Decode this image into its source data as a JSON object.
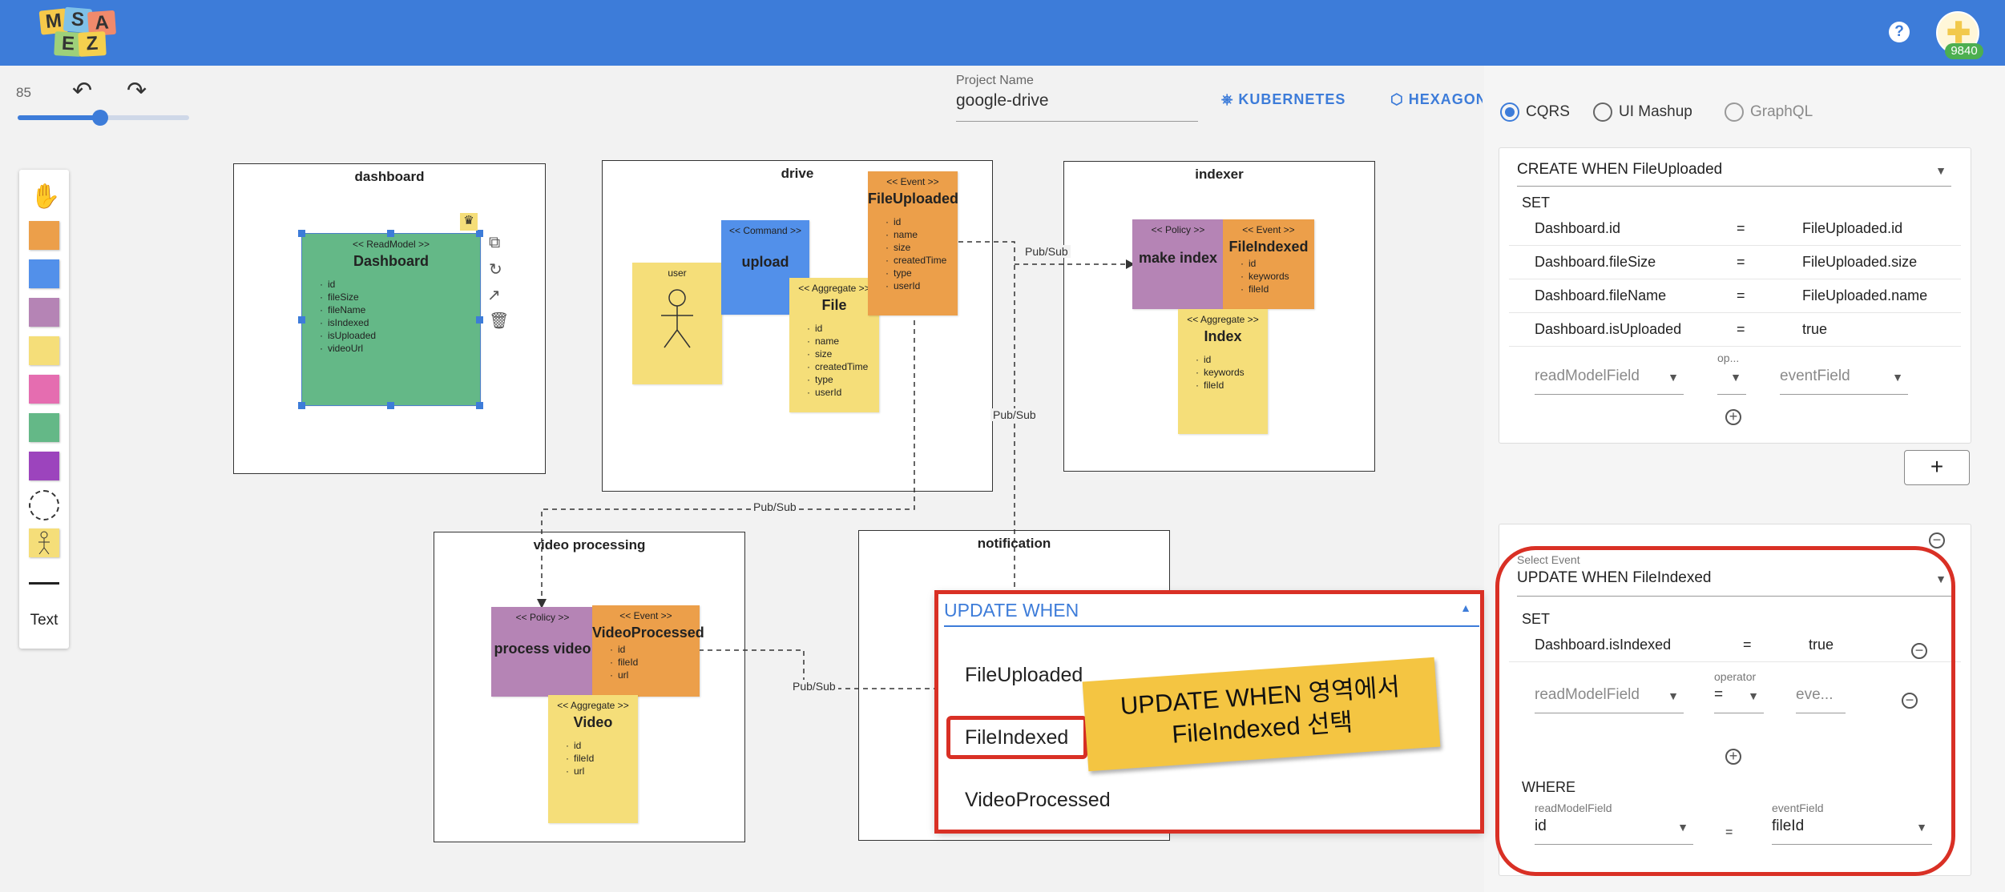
{
  "header": {
    "logo_letters": [
      "M",
      "S",
      "A",
      "E",
      "Z"
    ],
    "help_glyph": "?",
    "user_badge": "9840"
  },
  "toolbar": {
    "zoom": 85,
    "zoom_percent": 48,
    "undo_glyph": "↶",
    "redo_glyph": "↷"
  },
  "palette": {
    "items": [
      "hand-tool",
      "event-sticker",
      "command-sticker",
      "policy-sticker",
      "readmodel-sticker",
      "external-sticker",
      "aggregate-sticker",
      "ui-sticker",
      "boundary-tool",
      "actor-sticker",
      "line-tool"
    ],
    "text_label": "Text",
    "colors": {
      "event": "#ec9f4a",
      "command": "#5290ea",
      "policy": "#b584b5",
      "readmodel": "#64b887",
      "aggregate": "#f5de79",
      "external": "#e56db0",
      "ui": "#9c44bd"
    }
  },
  "project": {
    "label": "Project Name",
    "name": "google-drive"
  },
  "vendors": [
    "KUBERNETES",
    "HEXAGONAL"
  ],
  "canvas": {
    "contexts": [
      "dashboard",
      "drive",
      "indexer",
      "video processing",
      "notification"
    ],
    "stickers": {
      "dashboard": {
        "type": "<< ReadModel >>",
        "name": "Dashboard",
        "fields": [
          "id",
          "fileSize",
          "fileName",
          "isIndexed",
          "isUploaded",
          "videoUrl"
        ]
      },
      "user": {
        "type": "user"
      },
      "upload": {
        "type": "<< Command >>",
        "name": "upload"
      },
      "file_uploaded": {
        "type": "<< Event >>",
        "name": "FileUploaded",
        "fields": [
          "id",
          "name",
          "size",
          "createdTime",
          "type",
          "userId"
        ]
      },
      "file": {
        "type": "<< Aggregate >>",
        "name": "File",
        "fields": [
          "id",
          "name",
          "size",
          "createdTime",
          "type",
          "userId"
        ]
      },
      "make_index": {
        "type": "<< Policy >>",
        "name": "make index"
      },
      "file_indexed": {
        "type": "<< Event >>",
        "name": "FileIndexed",
        "fields": [
          "id",
          "keywords",
          "fileId"
        ]
      },
      "index": {
        "type": "<< Aggregate >>",
        "name": "Index",
        "fields": [
          "id",
          "keywords",
          "fileId"
        ]
      },
      "process_video": {
        "type": "<< Policy >>",
        "name": "process video"
      },
      "video_processed": {
        "type": "<< Event >>",
        "name": "VideoProcessed",
        "fields": [
          "id",
          "fileId",
          "url"
        ]
      },
      "video": {
        "type": "<< Aggregate >>",
        "name": "Video",
        "fields": [
          "id",
          "fileId",
          "url"
        ]
      }
    },
    "connection_label": "Pub/Sub"
  },
  "panel": {
    "modes": [
      "CQRS",
      "UI Mashup",
      "GraphQL"
    ],
    "selected_mode": "CQRS",
    "create_card": {
      "select_value": "CREATE WHEN FileUploaded",
      "set_label": "SET",
      "rows": [
        {
          "field": "Dashboard.id",
          "op": "=",
          "value": "FileUploaded.id"
        },
        {
          "field": "Dashboard.fileSize",
          "op": "=",
          "value": "FileUploaded.size"
        },
        {
          "field": "Dashboard.fileName",
          "op": "=",
          "value": "FileUploaded.name"
        },
        {
          "field": "Dashboard.isUploaded",
          "op": "=",
          "value": "true"
        }
      ],
      "new_row": {
        "field_placeholder": "readModelField",
        "op_label": "op...",
        "event_placeholder": "eventField"
      }
    },
    "add_button": "+",
    "update_card": {
      "select_label": "Select Event",
      "select_value": "UPDATE WHEN FileIndexed",
      "set_label": "SET",
      "row": {
        "field": "Dashboard.isIndexed",
        "op": "=",
        "value": "true"
      },
      "new_row": {
        "field_placeholder": "readModelField",
        "op_label": "operator",
        "op_value": "=",
        "event_placeholder": "eve..."
      },
      "where_label": "WHERE",
      "where": {
        "field_label": "readModelField",
        "field_value": "id",
        "op": "=",
        "event_label": "eventField",
        "event_value": "fileId"
      }
    }
  },
  "dropdown": {
    "title": "UPDATE WHEN",
    "options": [
      "FileUploaded",
      "FileIndexed",
      "VideoProcessed"
    ],
    "highlighted": "FileIndexed"
  },
  "callout": {
    "line1": "UPDATE WHEN 영역에서",
    "line2": "FileIndexed 선택",
    "color": "#f4c542"
  },
  "highlight_color": "#d93025"
}
